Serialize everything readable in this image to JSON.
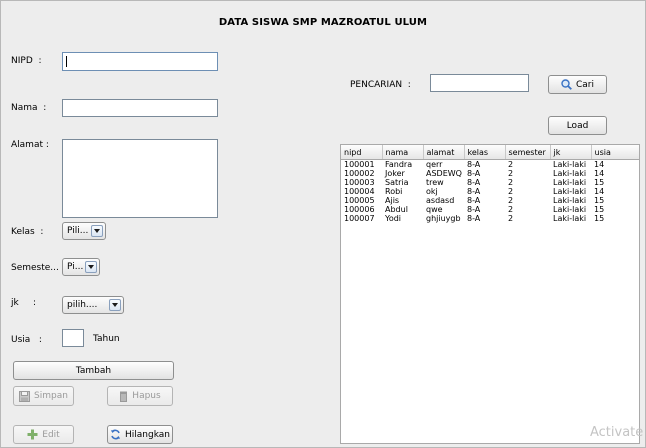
{
  "title": "DATA SISWA SMP MAZROATUL ULUM",
  "form": {
    "nipd_label": "NIPD  :",
    "nipd_value": "",
    "nama_label": "Nama  :",
    "nama_value": "",
    "alamat_label": "Alamat :",
    "alamat_value": "",
    "kelas_label": "Kelas  :",
    "kelas_value": "Pili...",
    "semester_label": "Semeste...",
    "semester_value": "Pi...",
    "jk_label": "jk     :",
    "jk_value": "pilih....",
    "usia_label": "Usia   :",
    "usia_value": "",
    "tahun_label": "Tahun"
  },
  "buttons": {
    "tambah": "Tambah",
    "simpan": "Simpan",
    "hapus": "Hapus",
    "edit": "Edit",
    "hilangkan": "Hilangkan",
    "cari": "Cari",
    "load": "Load"
  },
  "search": {
    "label": "PENCARIAN  :",
    "value": ""
  },
  "table": {
    "columns": [
      "nipd",
      "nama",
      "alamat",
      "kelas",
      "semester",
      "jk",
      "usia"
    ],
    "rows": [
      [
        "100001",
        "Fandra",
        "qerr",
        "8-A",
        "2",
        "Laki-laki",
        "14"
      ],
      [
        "100002",
        "Joker",
        "ASDEWQ",
        "8-A",
        "2",
        "Laki-laki",
        "14"
      ],
      [
        "100003",
        "Satria",
        "trew",
        "8-A",
        "2",
        "Laki-laki",
        "15"
      ],
      [
        "100004",
        "Robi",
        "okj",
        "8-A",
        "2",
        "Laki-laki",
        "14"
      ],
      [
        "100005",
        "Ajis",
        "asdasd",
        "8-A",
        "2",
        "Laki-laki",
        "15"
      ],
      [
        "100006",
        "Abdul",
        "qwe",
        "8-A",
        "2",
        "Laki-laki",
        "15"
      ],
      [
        "100007",
        "Yodi",
        "ghjiuygb",
        "8-A",
        "2",
        "Laki-laki",
        "15"
      ]
    ]
  },
  "watermark": "Activate W"
}
